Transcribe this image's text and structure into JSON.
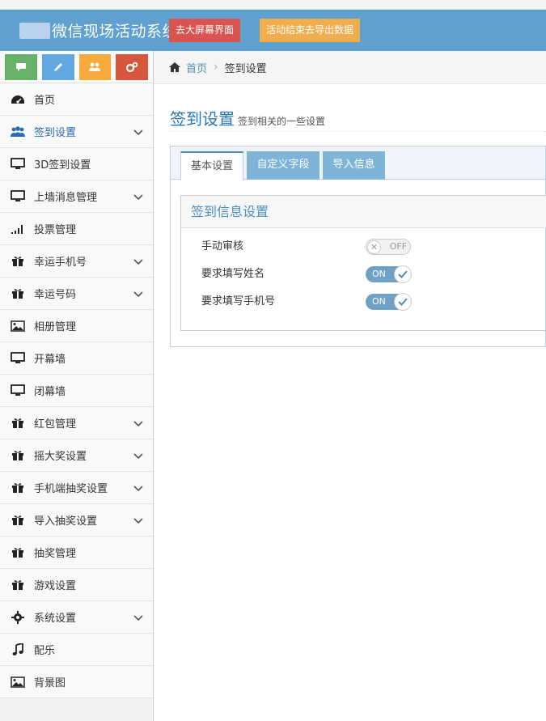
{
  "header": {
    "brand_text": "微信现场活动系统",
    "btn_fullscreen": "去大屏幕界面",
    "btn_export": "活动结束去导出数据",
    "colors": {
      "bar": "#5fa0cf",
      "red": "#d9534f",
      "orange": "#f0ad4e"
    }
  },
  "shortcuts": [
    {
      "icon": "comment-icon",
      "color": "#68b168"
    },
    {
      "icon": "pencil-icon",
      "color": "#61a8e0"
    },
    {
      "icon": "group-icon",
      "color": "#f8a93b"
    },
    {
      "icon": "cogs-icon",
      "color": "#d6553d"
    }
  ],
  "sidebar": {
    "items": [
      {
        "label": "首页",
        "icon": "dashboard-icon",
        "has_children": false
      },
      {
        "label": "签到设置",
        "icon": "users-icon",
        "has_children": true,
        "active": true
      },
      {
        "label": "3D签到设置",
        "icon": "desktop-icon",
        "has_children": false
      },
      {
        "label": "上墙消息管理",
        "icon": "desktop-icon",
        "has_children": true
      },
      {
        "label": "投票管理",
        "icon": "signal-icon",
        "has_children": false
      },
      {
        "label": "幸运手机号",
        "icon": "gift-icon",
        "has_children": true
      },
      {
        "label": "幸运号码",
        "icon": "gift-icon",
        "has_children": true
      },
      {
        "label": "相册管理",
        "icon": "picture-icon",
        "has_children": false
      },
      {
        "label": "开幕墙",
        "icon": "desktop-icon",
        "has_children": false
      },
      {
        "label": "闭幕墙",
        "icon": "desktop-icon",
        "has_children": false
      },
      {
        "label": "红包管理",
        "icon": "gift-icon",
        "has_children": true
      },
      {
        "label": "摇大奖设置",
        "icon": "gift-icon",
        "has_children": true
      },
      {
        "label": "手机端抽奖设置",
        "icon": "gift-icon",
        "has_children": true
      },
      {
        "label": "导入抽奖设置",
        "icon": "gift-icon",
        "has_children": true
      },
      {
        "label": "抽奖管理",
        "icon": "gift-icon",
        "has_children": false
      },
      {
        "label": "游戏设置",
        "icon": "gift-icon",
        "has_children": false
      },
      {
        "label": "系统设置",
        "icon": "cog-icon",
        "has_children": true
      },
      {
        "label": "配乐",
        "icon": "music-icon",
        "has_children": false
      },
      {
        "label": "背景图",
        "icon": "picture-icon",
        "has_children": false
      }
    ]
  },
  "breadcrumb": {
    "home": "首页",
    "current": "签到设置"
  },
  "page": {
    "title": "签到设置",
    "subtitle": "签到相关的一些设置"
  },
  "tabs": [
    {
      "label": "基本设置",
      "active": true
    },
    {
      "label": "自定义字段",
      "active": false
    },
    {
      "label": "导入信息",
      "active": false
    }
  ],
  "widget": {
    "title": "签到信息设置",
    "rows": [
      {
        "label": "手动审核",
        "state": "OFF"
      },
      {
        "label": "要求填写姓名",
        "state": "ON"
      },
      {
        "label": "要求填写手机号",
        "state": "ON"
      }
    ]
  }
}
